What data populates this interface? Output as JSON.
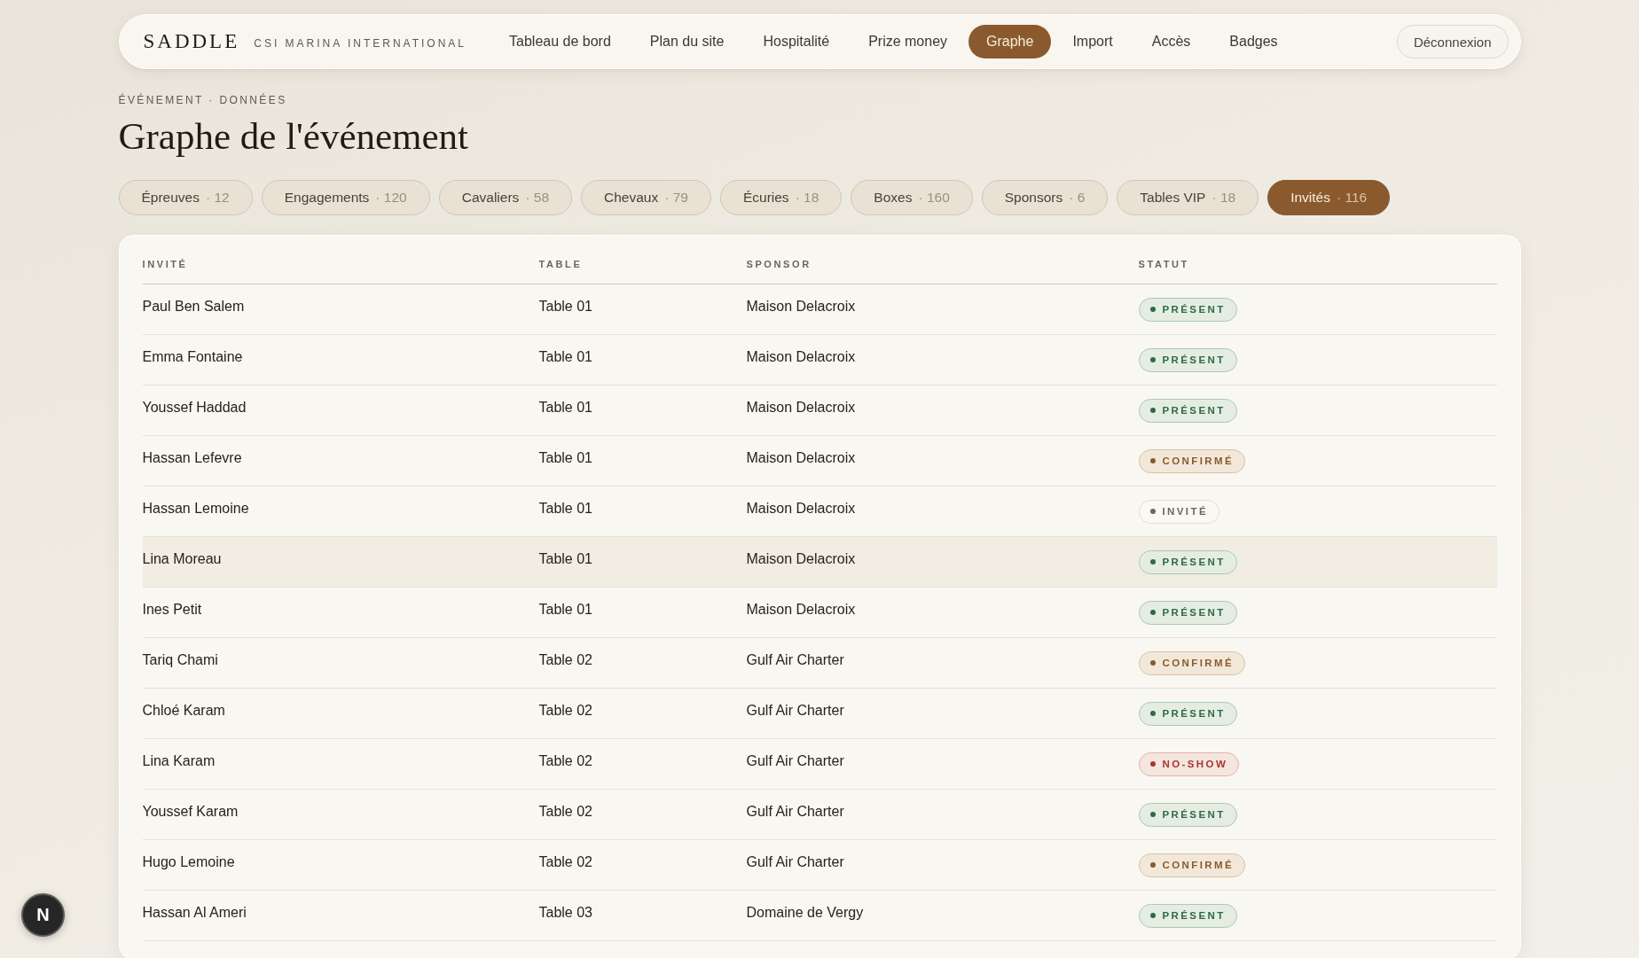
{
  "header": {
    "brand": "SADDLE",
    "event": "CSI MARINA INTERNATIONAL",
    "nav": [
      {
        "label": "Tableau de bord",
        "selected": false
      },
      {
        "label": "Plan du site",
        "selected": false
      },
      {
        "label": "Hospitalité",
        "selected": false
      },
      {
        "label": "Prize money",
        "selected": false
      },
      {
        "label": "Graphe",
        "selected": true
      },
      {
        "label": "Import",
        "selected": false
      },
      {
        "label": "Accès",
        "selected": false
      },
      {
        "label": "Badges",
        "selected": false
      }
    ],
    "logout": "Déconnexion"
  },
  "breadcrumb": "ÉVÉNEMENT · DONNÉES",
  "title": "Graphe de l'événement",
  "filters": [
    {
      "label": "Épreuves",
      "count": "· 12",
      "selected": false
    },
    {
      "label": "Engagements",
      "count": "· 120",
      "selected": false
    },
    {
      "label": "Cavaliers",
      "count": "· 58",
      "selected": false
    },
    {
      "label": "Chevaux",
      "count": "· 79",
      "selected": false
    },
    {
      "label": "Écuries",
      "count": "· 18",
      "selected": false
    },
    {
      "label": "Boxes",
      "count": "· 160",
      "selected": false
    },
    {
      "label": "Sponsors",
      "count": "· 6",
      "selected": false
    },
    {
      "label": "Tables VIP",
      "count": "· 18",
      "selected": false
    },
    {
      "label": "Invités",
      "count": "· 116",
      "selected": true
    }
  ],
  "table": {
    "columns": [
      "INVITÉ",
      "TABLE",
      "SPONSOR",
      "STATUT"
    ],
    "rows": [
      {
        "guest": "Paul Ben Salem",
        "table": "Table 01",
        "sponsor": "Maison Delacroix",
        "status": {
          "label": "PRÉSENT",
          "kind": "present"
        },
        "selected": false
      },
      {
        "guest": "Emma Fontaine",
        "table": "Table 01",
        "sponsor": "Maison Delacroix",
        "status": {
          "label": "PRÉSENT",
          "kind": "present"
        },
        "selected": false
      },
      {
        "guest": "Youssef Haddad",
        "table": "Table 01",
        "sponsor": "Maison Delacroix",
        "status": {
          "label": "PRÉSENT",
          "kind": "present"
        },
        "selected": false
      },
      {
        "guest": "Hassan Lefevre",
        "table": "Table 01",
        "sponsor": "Maison Delacroix",
        "status": {
          "label": "CONFIRMÉ",
          "kind": "confirmed"
        },
        "selected": false
      },
      {
        "guest": "Hassan Lemoine",
        "table": "Table 01",
        "sponsor": "Maison Delacroix",
        "status": {
          "label": "INVITÉ",
          "kind": "invited"
        },
        "selected": false
      },
      {
        "guest": "Lina Moreau",
        "table": "Table 01",
        "sponsor": "Maison Delacroix",
        "status": {
          "label": "PRÉSENT",
          "kind": "present"
        },
        "selected": true
      },
      {
        "guest": "Ines Petit",
        "table": "Table 01",
        "sponsor": "Maison Delacroix",
        "status": {
          "label": "PRÉSENT",
          "kind": "present"
        },
        "selected": false
      },
      {
        "guest": "Tariq Chami",
        "table": "Table 02",
        "sponsor": "Gulf Air Charter",
        "status": {
          "label": "CONFIRMÉ",
          "kind": "confirmed"
        },
        "selected": false
      },
      {
        "guest": "Chloé Karam",
        "table": "Table 02",
        "sponsor": "Gulf Air Charter",
        "status": {
          "label": "PRÉSENT",
          "kind": "present"
        },
        "selected": false
      },
      {
        "guest": "Lina Karam",
        "table": "Table 02",
        "sponsor": "Gulf Air Charter",
        "status": {
          "label": "NO-SHOW",
          "kind": "no_show"
        },
        "selected": false
      },
      {
        "guest": "Youssef Karam",
        "table": "Table 02",
        "sponsor": "Gulf Air Charter",
        "status": {
          "label": "PRÉSENT",
          "kind": "present"
        },
        "selected": false
      },
      {
        "guest": "Hugo Lemoine",
        "table": "Table 02",
        "sponsor": "Gulf Air Charter",
        "status": {
          "label": "CONFIRMÉ",
          "kind": "confirmed"
        },
        "selected": false
      },
      {
        "guest": "Hassan Al Ameri",
        "table": "Table 03",
        "sponsor": "Domaine de Vergy",
        "status": {
          "label": "PRÉSENT",
          "kind": "present"
        },
        "selected": false
      }
    ]
  },
  "dev_indicator": {
    "label": "N"
  }
}
